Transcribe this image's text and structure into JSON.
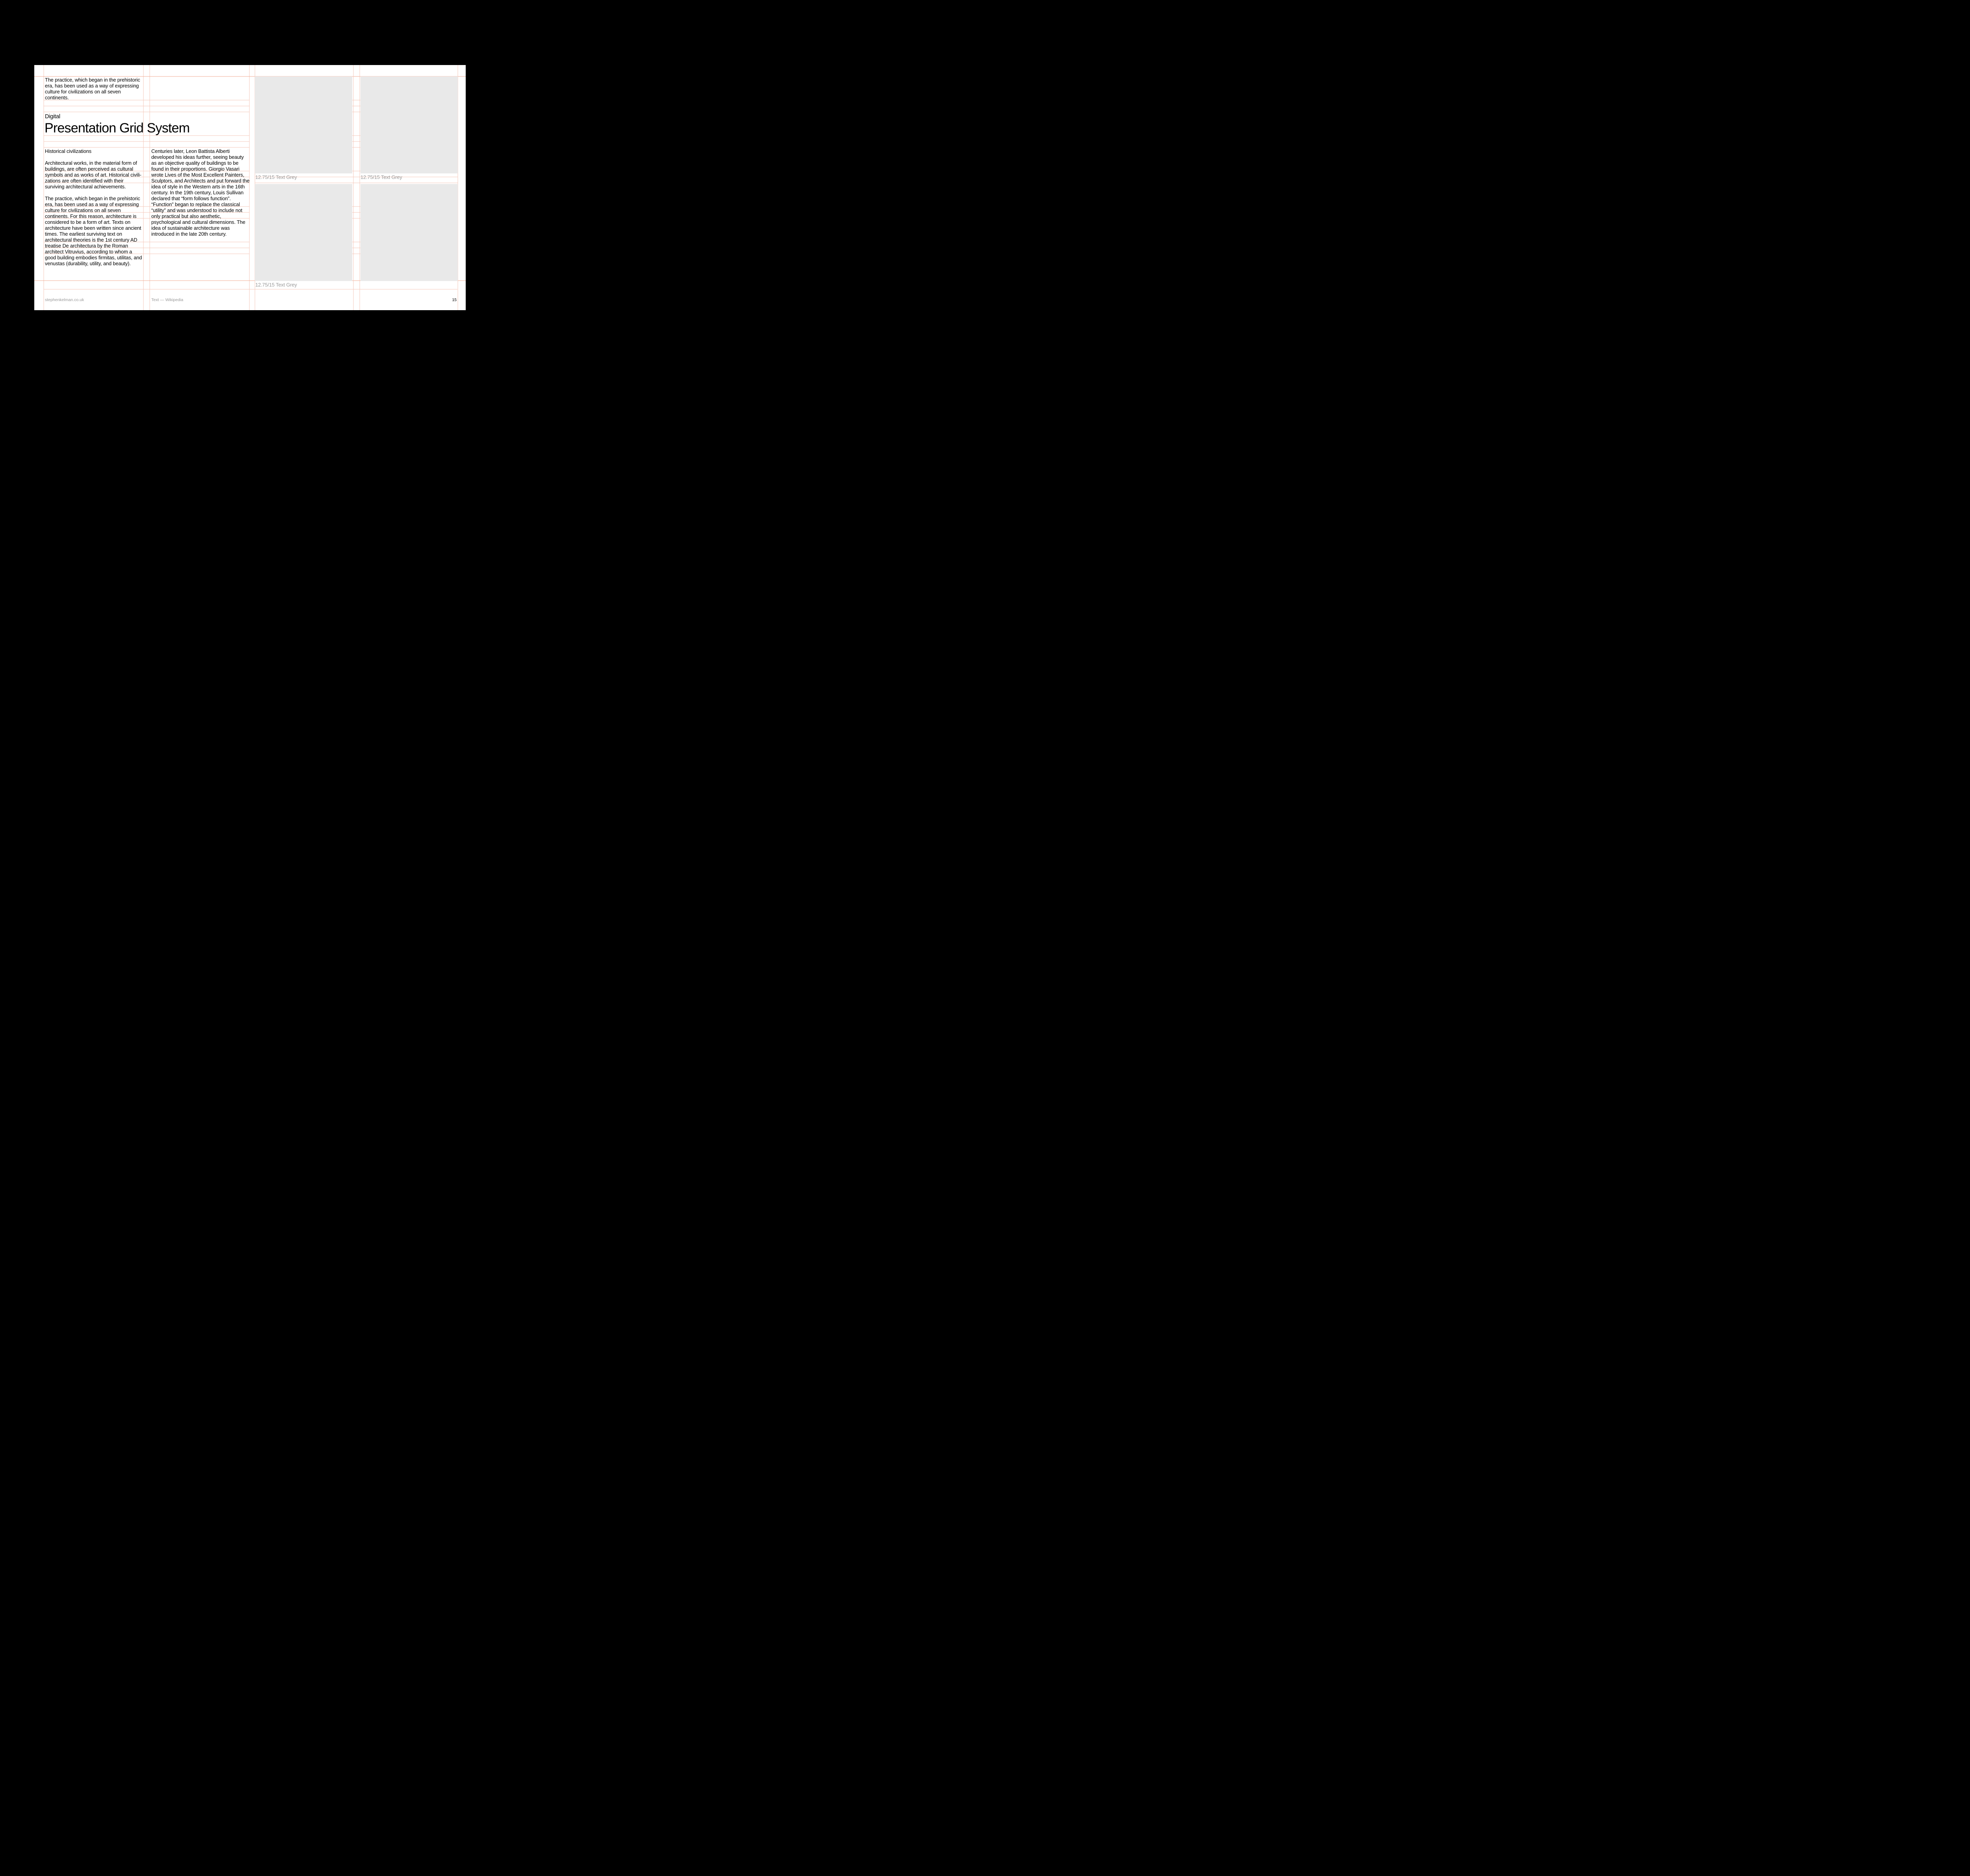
{
  "intro": "The practice, which began in the prehistoric era, has been used as a way of expressing culture for civilizations on all seven continents.",
  "eyebrow": "Digital",
  "title": "Presentation Grid System",
  "col1": {
    "subtitle": "Historical civilizations",
    "p1": "Architectural works, in the material form of buildings, are often perceived as cultural symbols and as works of art. Historical civili­zations are often identified with their surviving architectural achievements.",
    "p2": "The practice, which began in the prehistoric era, has been used as a way of expressing culture for civilizations on all seven continents. For this reason, architecture is considered to be a form of art. Texts on architecture have been written since ancient times. The earliest surviving text on architectural theories is the 1st century AD treatise De architectura by the Roman architect Vitruvius, according to whom a good building embodies firmitas, utilitas, and venustas (durability, utility, and beauty)."
  },
  "col2": {
    "p1": "Centuries later, Leon Battista Alberti developed his ideas further, seeing beauty as an objective quality of buildings to be found in their propor­tions. Giorgio Vasari wrote Lives of the Most Excellent Painters, Sculptors, and Architects and put forward the idea of style in the Western arts in the 16th century. In the 19th century, Louis Sullivan declared that “form follows function”. “Function” began to replace the classical “utility” and was understood to include not only practical but also aesthetic, psychological and cultural dimensions. The idea of sustainable architecture was introduced in the late 20th century."
  },
  "captions": {
    "c1": "12.75/15 Text Grey",
    "c2": "12.75/15 Text Grey",
    "c3": "12.75/15 Text Grey"
  },
  "footer": {
    "left": "stephenkelman.co.uk",
    "source": "Text — Wikipedia",
    "page": "15"
  }
}
